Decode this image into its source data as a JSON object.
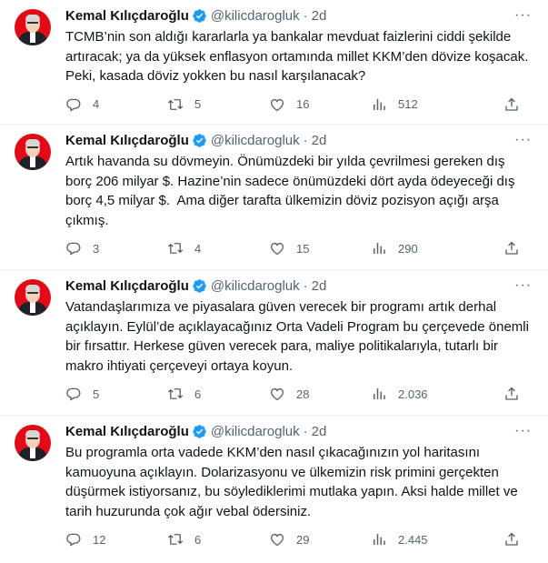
{
  "tweets": [
    {
      "name": "Kemal Kılıçdaroğlu",
      "handle": "@kilicdarogluk",
      "time": "2d",
      "text": "TCMB’nin son aldığı kararlarla ya bankalar mevduat faizlerini ciddi şekilde artıracak; ya da yüksek enflasyon ortamında millet KKM’den dövize koşacak. Peki, kasada döviz yokken bu nasıl karşılanacak?",
      "replies": "4",
      "retweets": "5",
      "likes": "16",
      "views": "512"
    },
    {
      "name": "Kemal Kılıçdaroğlu",
      "handle": "@kilicdarogluk",
      "time": "2d",
      "text": "Artık havanda su dövmeyin. Önümüzdeki bir yılda çevrilmesi gereken dış borç 206 milyar $. Hazine’nin sadece önümüzdeki dört ayda ödeyeceği dış borç 4,5 milyar $.  Ama diğer tarafta ülkemizin döviz pozisyon açığı arşa çıkmış.",
      "replies": "3",
      "retweets": "4",
      "likes": "15",
      "views": "290"
    },
    {
      "name": "Kemal Kılıçdaroğlu",
      "handle": "@kilicdarogluk",
      "time": "2d",
      "text": "Vatandaşlarımıza ve piyasalara güven verecek bir programı artık derhal açıklayın. Eylül’de açıklayacağınız Orta Vadeli Program bu çerçevede önemli bir fırsattır. Herkese güven verecek para, maliye politikalarıyla, tutarlı bir makro ihtiyati çerçeveyi ortaya koyun.",
      "replies": "5",
      "retweets": "6",
      "likes": "28",
      "views": "2.036"
    },
    {
      "name": "Kemal Kılıçdaroğlu",
      "handle": "@kilicdarogluk",
      "time": "2d",
      "text": "Bu programla orta vadede KKM’den nasıl çıkacağınızın yol haritasını kamuoyuna açıklayın. Dolarizasyonu ve ülkemizin risk primini gerçekten düşürmek istiyorsanız, bu söylediklerimi mutlaka yapın. Aksi halde millet ve tarih huzurunda çok ağır vebal ödersiniz.",
      "replies": "12",
      "retweets": "6",
      "likes": "29",
      "views": "2.445"
    }
  ],
  "dot_separator": "·",
  "more_glyph": "···",
  "colors": {
    "verified": "#1d9bf0",
    "muted": "#536471",
    "text": "#0f1419"
  },
  "icons": [
    "verified-badge-icon",
    "more-icon",
    "reply-icon",
    "retweet-icon",
    "like-icon",
    "views-icon",
    "share-icon"
  ]
}
